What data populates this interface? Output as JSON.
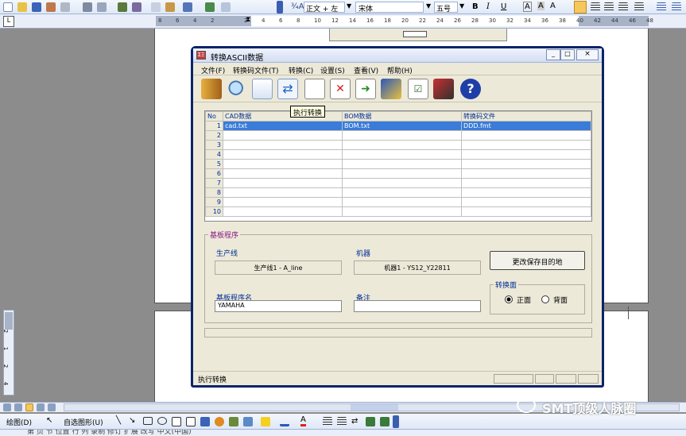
{
  "word": {
    "toolbar": {
      "style": "正文 + 左",
      "font": "宋体",
      "size": "五号",
      "bold": "B",
      "italic": "I",
      "underline": "U",
      "font_color": "A",
      "highlight": "A"
    },
    "ruler_marks": [
      "8",
      "6",
      "4",
      "2",
      "2",
      "4",
      "6",
      "8",
      "10",
      "12",
      "14",
      "16",
      "18",
      "20",
      "22",
      "24",
      "26",
      "28",
      "30",
      "32",
      "34",
      "36",
      "38",
      "40",
      "42",
      "44",
      "46",
      "48"
    ],
    "vertical_ruler_marks": [
      "2",
      "1",
      "2",
      "4"
    ],
    "draw_toolbar": {
      "draw_label": "绘图(D)",
      "autoshape_label": "自选图形(U)"
    },
    "watermark": "SMT顶级人脉圈",
    "status_truncated": "第 页 节 位置 行 列 录制 修订 扩展 改写 中文(中国)"
  },
  "dialog": {
    "title": "转换ASCII数据",
    "title_buttons": [
      "_",
      "□",
      "×"
    ],
    "menu": [
      "文件(F)",
      "转换码文件(T)",
      "转换(C)",
      "设置(S)",
      "查看(V)",
      "帮助(H)"
    ],
    "tooltip": "执行转换",
    "table": {
      "headers": [
        "No",
        "CAD数据",
        "BOM数据",
        "转换码文件"
      ],
      "rows": [
        {
          "no": "1",
          "cad": "cad.txt",
          "bom": "BOM.txt",
          "conv": "DDD.fmt"
        },
        {
          "no": "2",
          "cad": "",
          "bom": "",
          "conv": ""
        },
        {
          "no": "3",
          "cad": "",
          "bom": "",
          "conv": ""
        },
        {
          "no": "4",
          "cad": "",
          "bom": "",
          "conv": ""
        },
        {
          "no": "5",
          "cad": "",
          "bom": "",
          "conv": ""
        },
        {
          "no": "6",
          "cad": "",
          "bom": "",
          "conv": ""
        },
        {
          "no": "7",
          "cad": "",
          "bom": "",
          "conv": ""
        },
        {
          "no": "8",
          "cad": "",
          "bom": "",
          "conv": ""
        },
        {
          "no": "9",
          "cad": "",
          "bom": "",
          "conv": ""
        },
        {
          "no": "10",
          "cad": "",
          "bom": "",
          "conv": ""
        }
      ]
    },
    "group": {
      "title": "基板程序",
      "line_label": "生产线",
      "line_value": "生产线1 - A_line",
      "machine_label": "机器",
      "machine_value": "机器1 - YS12_Y22811",
      "change_button": "更改保存目的地",
      "program_label": "基板程序名",
      "program_value": "YAMAHA",
      "remark_label": "备注",
      "remark_value": "",
      "side_title": "转换面",
      "side_front": "正面",
      "side_back": "背面"
    },
    "status": "执行转换"
  }
}
